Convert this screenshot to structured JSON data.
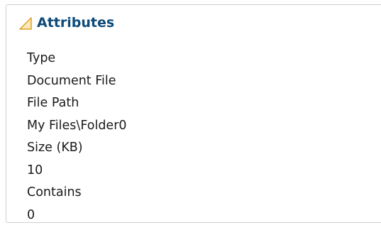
{
  "panel": {
    "title": "Attributes",
    "toggle_icon": "triangle-collapse-icon"
  },
  "attributes": [
    {
      "label": "Type",
      "value": "Document File"
    },
    {
      "label": "File Path",
      "value": "My Files\\Folder0"
    },
    {
      "label": "Size (KB)",
      "value": "10"
    },
    {
      "label": "Contains",
      "value": "0"
    }
  ],
  "colors": {
    "title": "#0e4b7a",
    "icon_stroke": "#e0a020",
    "icon_fill": "#fbeab8",
    "border": "#cfcfcf"
  }
}
